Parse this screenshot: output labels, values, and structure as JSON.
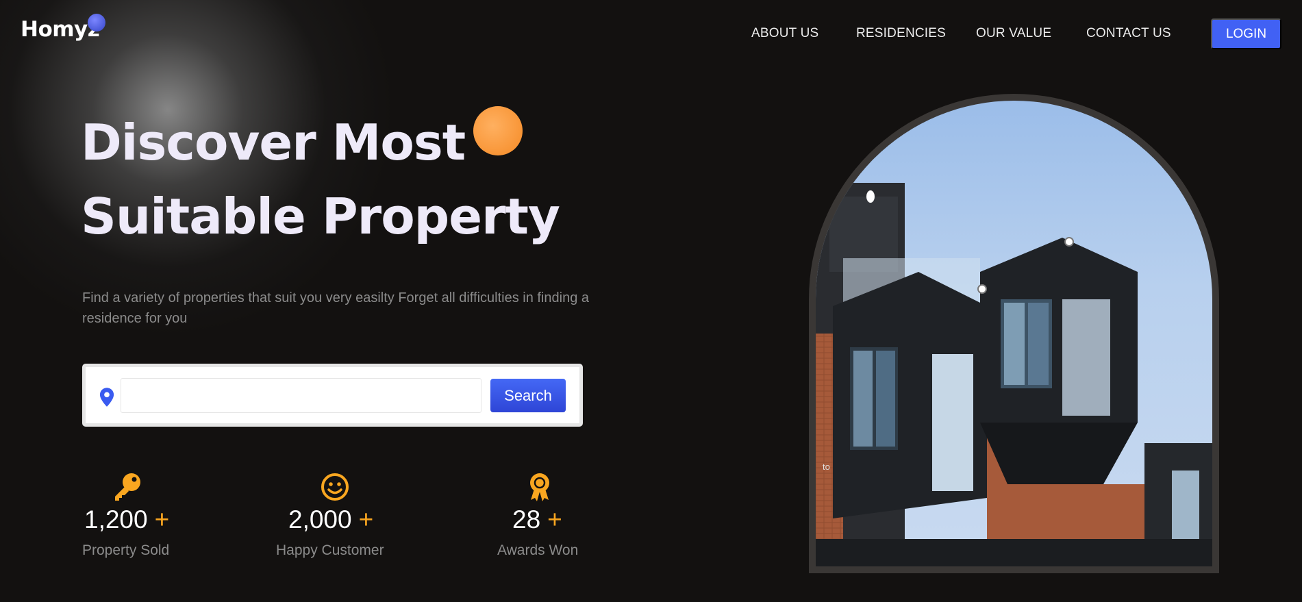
{
  "brand": {
    "name": "Homyz"
  },
  "nav": {
    "items": [
      "ABOUT US",
      "RESIDENCIES",
      "OUR VALUE",
      "CONTACT US"
    ],
    "login_label": "LOGIN"
  },
  "hero": {
    "title_line1": "Discover Most",
    "title_line2": "Suitable Property",
    "description": "Find a variety of properties that suit you very easilty Forget all difficulties in finding a residence for you"
  },
  "search": {
    "value": "",
    "button_label": "Search",
    "icon": "map-pin-icon"
  },
  "stats": [
    {
      "value": "1,200",
      "suffix": "+",
      "label": "Property Sold",
      "icon": "key-icon"
    },
    {
      "value": "2,000",
      "suffix": "+",
      "label": "Happy Customer",
      "icon": "smile-icon"
    },
    {
      "value": "28",
      "suffix": "+",
      "label": "Awards Won",
      "icon": "award-icon"
    }
  ],
  "image": {
    "caption_fragment": "to"
  },
  "colors": {
    "background": "#131110",
    "accent_blue": "#4161f4",
    "accent_orange": "#f9a620",
    "muted_text": "#8b8b8b"
  }
}
